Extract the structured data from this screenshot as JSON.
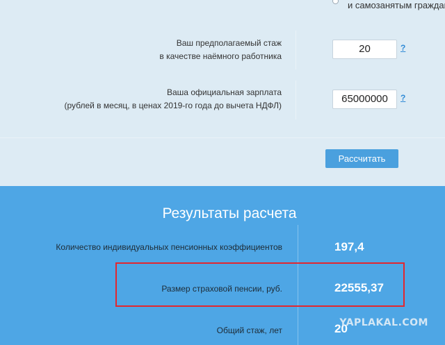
{
  "top_option": {
    "label": "и самозанятым гражданам"
  },
  "form": {
    "experience": {
      "label_line1": "Ваш предполагаемый стаж",
      "label_line2": "в качестве наёмного работника",
      "value": "20",
      "help": "?"
    },
    "salary": {
      "label_line1": "Ваша официальная зарплата",
      "label_line2": "(рублей в месяц, в ценах 2019-го года до вычета НДФЛ)",
      "value": "65000000",
      "help": "?"
    },
    "calculate_button": "Рассчитать"
  },
  "results": {
    "title": "Результаты расчета",
    "rows": [
      {
        "label": "Количество индивидуальных пенсионных коэффициентов",
        "value": "197,4"
      },
      {
        "label": "Размер страховой пенсии, руб.",
        "value": "22555,37"
      },
      {
        "label": "Общий стаж, лет",
        "value": "20"
      }
    ]
  },
  "watermark": "YAPLAKAL.COM",
  "colors": {
    "form_bg": "#ddebf4",
    "results_bg": "#4ea6e5",
    "button_bg": "#4aa0de",
    "highlight": "#e3262e"
  }
}
